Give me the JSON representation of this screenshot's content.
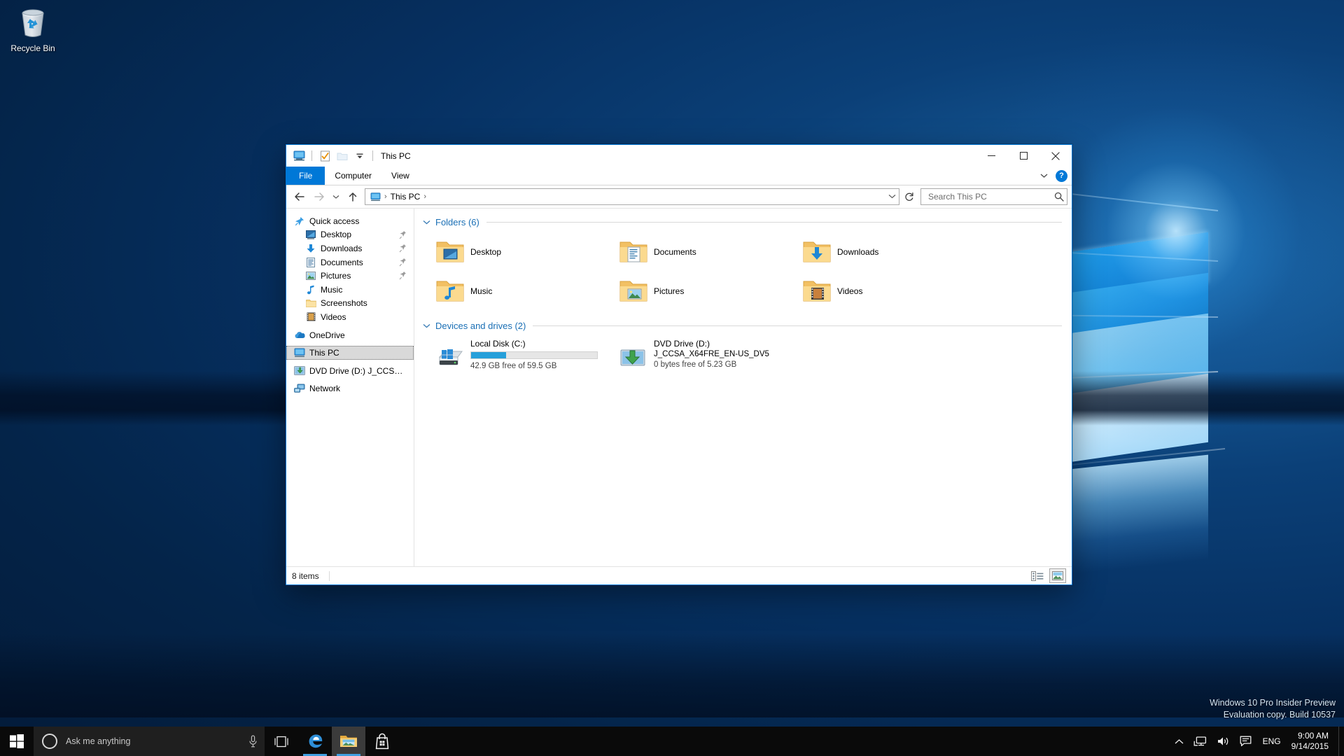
{
  "desktop": {
    "recycle_bin": {
      "label": "Recycle Bin",
      "icon": "recycle-bin-icon"
    },
    "watermark": {
      "line1": "Windows 10 Pro Insider Preview",
      "line2": "Evaluation copy. Build 10537"
    }
  },
  "explorer": {
    "title": "This PC",
    "quick_access_toolbar": [
      {
        "name": "this-pc-icon",
        "label": "This PC"
      },
      {
        "name": "properties-icon",
        "label": "Properties"
      },
      {
        "name": "new-folder-icon",
        "label": "New folder"
      },
      {
        "name": "customize-qat-chevron-icon",
        "label": "Customize Quick Access Toolbar"
      }
    ],
    "window_controls": {
      "minimize": "─",
      "maximize": "☐",
      "close": "✕"
    },
    "ribbon_tabs": [
      {
        "label": "File",
        "active": true
      },
      {
        "label": "Computer",
        "active": false
      },
      {
        "label": "View",
        "active": false
      }
    ],
    "ribbon_expand_icon": "chevron-down-icon",
    "help_label": "?",
    "navigation": {
      "back": "←",
      "forward": "→",
      "recent": "⌄",
      "up": "↑",
      "refresh": "↻",
      "breadcrumb": [
        "This PC"
      ],
      "breadcrumb_separator": "›",
      "address_dropdown_icon": "chevron-down-icon"
    },
    "search": {
      "placeholder": "Search This PC",
      "value": "",
      "icon": "search-icon"
    },
    "sidebar": [
      {
        "label": "Quick access",
        "icon": "quick-access-pin-icon",
        "indent": false,
        "pinned": false,
        "selected": false
      },
      {
        "label": "Desktop",
        "icon": "desktop-icon",
        "indent": true,
        "pinned": true,
        "selected": false
      },
      {
        "label": "Downloads",
        "icon": "downloads-icon",
        "indent": true,
        "pinned": true,
        "selected": false
      },
      {
        "label": "Documents",
        "icon": "documents-icon",
        "indent": true,
        "pinned": true,
        "selected": false
      },
      {
        "label": "Pictures",
        "icon": "pictures-icon",
        "indent": true,
        "pinned": true,
        "selected": false
      },
      {
        "label": "Music",
        "icon": "music-icon",
        "indent": true,
        "pinned": false,
        "selected": false
      },
      {
        "label": "Screenshots",
        "icon": "folder-icon",
        "indent": true,
        "pinned": false,
        "selected": false
      },
      {
        "label": "Videos",
        "icon": "videos-icon",
        "indent": true,
        "pinned": false,
        "selected": false
      },
      {
        "label": "OneDrive",
        "icon": "onedrive-icon",
        "indent": false,
        "pinned": false,
        "selected": false
      },
      {
        "label": "This PC",
        "icon": "this-pc-icon",
        "indent": false,
        "pinned": false,
        "selected": true
      },
      {
        "label": "DVD Drive (D:) J_CCS…",
        "icon": "dvd-drive-icon",
        "indent": false,
        "pinned": false,
        "selected": false
      },
      {
        "label": "Network",
        "icon": "network-icon",
        "indent": false,
        "pinned": false,
        "selected": false
      }
    ],
    "groups": {
      "folders": {
        "title": "Folders (6)",
        "chevron": "⌄",
        "items": [
          {
            "label": "Desktop",
            "icon": "folder-desktop-icon"
          },
          {
            "label": "Documents",
            "icon": "folder-documents-icon"
          },
          {
            "label": "Downloads",
            "icon": "folder-downloads-icon"
          },
          {
            "label": "Music",
            "icon": "folder-music-icon"
          },
          {
            "label": "Pictures",
            "icon": "folder-pictures-icon"
          },
          {
            "label": "Videos",
            "icon": "folder-videos-icon"
          }
        ]
      },
      "devices": {
        "title": "Devices and drives (2)",
        "chevron": "⌄",
        "items": [
          {
            "name": "Local Disk (C:)",
            "subtitle": "",
            "free_text": "42.9 GB free of 59.5 GB",
            "used_percent": 28,
            "has_bar": true,
            "icon": "hard-drive-icon"
          },
          {
            "name": "DVD Drive (D:)",
            "subtitle": "J_CCSA_X64FRE_EN-US_DV5",
            "free_text": "0 bytes free of 5.23 GB",
            "used_percent": 100,
            "has_bar": false,
            "icon": "dvd-drive-icon"
          }
        ]
      }
    },
    "status": {
      "items_count": "8 items",
      "view_details_icon": "details-view-icon",
      "view_large_icons_icon": "large-icons-view-icon"
    }
  },
  "taskbar": {
    "start": {
      "icon": "windows-start-icon",
      "label": "Start"
    },
    "cortana": {
      "placeholder": "Ask me anything",
      "value": "",
      "circle_icon": "cortana-circle-icon",
      "mic_icon": "microphone-icon"
    },
    "buttons": [
      {
        "name": "task-view-button",
        "icon": "task-view-icon",
        "label": "Task View",
        "running": false,
        "active": false
      },
      {
        "name": "edge-button",
        "icon": "edge-icon",
        "label": "Microsoft Edge",
        "running": true,
        "active": false
      },
      {
        "name": "file-explorer-button",
        "icon": "file-explorer-icon",
        "label": "File Explorer",
        "running": true,
        "active": true
      },
      {
        "name": "store-button",
        "icon": "store-icon",
        "label": "Store",
        "running": false,
        "active": false
      }
    ],
    "tray": {
      "chevron": "∧",
      "network_icon": "network-tray-icon",
      "volume_icon": "volume-icon",
      "action_center_icon": "action-center-icon",
      "language": "ENG",
      "time": "9:00 AM",
      "date": "9/14/2015"
    }
  },
  "colors": {
    "accent": "#0078D7",
    "title_tab_file": "#0078D7",
    "group_heading": "#1A6FB5",
    "progress_fill": "#26A0DA",
    "progress_track": "#E6E6E6",
    "selection": "#CCE8FF",
    "taskbar": "#0A0A0A"
  }
}
